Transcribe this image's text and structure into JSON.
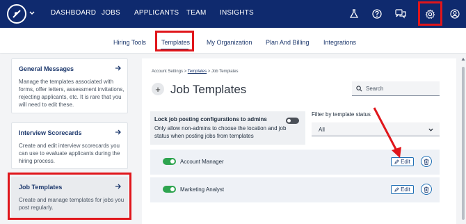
{
  "topnav": {
    "links": [
      "DASHBOARD",
      "JOBS",
      "APPLICANTS",
      "TEAM",
      "INSIGHTS"
    ],
    "icons": [
      "flask-icon",
      "help-icon",
      "chat-icon",
      "gear-icon",
      "user-icon"
    ]
  },
  "subnav": {
    "tabs": [
      "Hiring Tools",
      "Templates",
      "My Organization",
      "Plan And Billing",
      "Integrations"
    ],
    "active": "Templates"
  },
  "sidebar": {
    "cards": [
      {
        "title": "General Messages",
        "description": "Manage the templates associated with forms, offer letters, assessment invitations, rejecting applicants, etc. It is rare that you will need to edit these."
      },
      {
        "title": "Interview Scorecards",
        "description": "Create and edit interview scorecards you can use to evaluate applicants during the hiring process."
      },
      {
        "title": "Job Templates",
        "description": "Create and manage templates for jobs you post regularly."
      }
    ]
  },
  "main": {
    "breadcrumb": {
      "first": "Account Settings",
      "sep1": " > ",
      "link": "Templates",
      "sep2": " > ",
      "current": "Job Templates"
    },
    "add_symbol": "+",
    "title": "Job Templates",
    "search_placeholder": "Search",
    "lock": {
      "title": "Lock job posting configurations to admins",
      "description": "Only allow non-admins to choose the location and job status when posting jobs from templates",
      "enabled": false
    },
    "filter": {
      "label": "Filter by template status",
      "value": "All"
    },
    "templates": [
      {
        "name": "Account Manager",
        "active": true,
        "edit_label": "Edit"
      },
      {
        "name": "Marketing Analyst",
        "active": true,
        "edit_label": "Edit"
      }
    ]
  },
  "colors": {
    "nav_bg": "#0f2a6e",
    "highlight": "#e0161b",
    "toggle_on": "#2ea44f",
    "link": "#1f3a6e"
  }
}
